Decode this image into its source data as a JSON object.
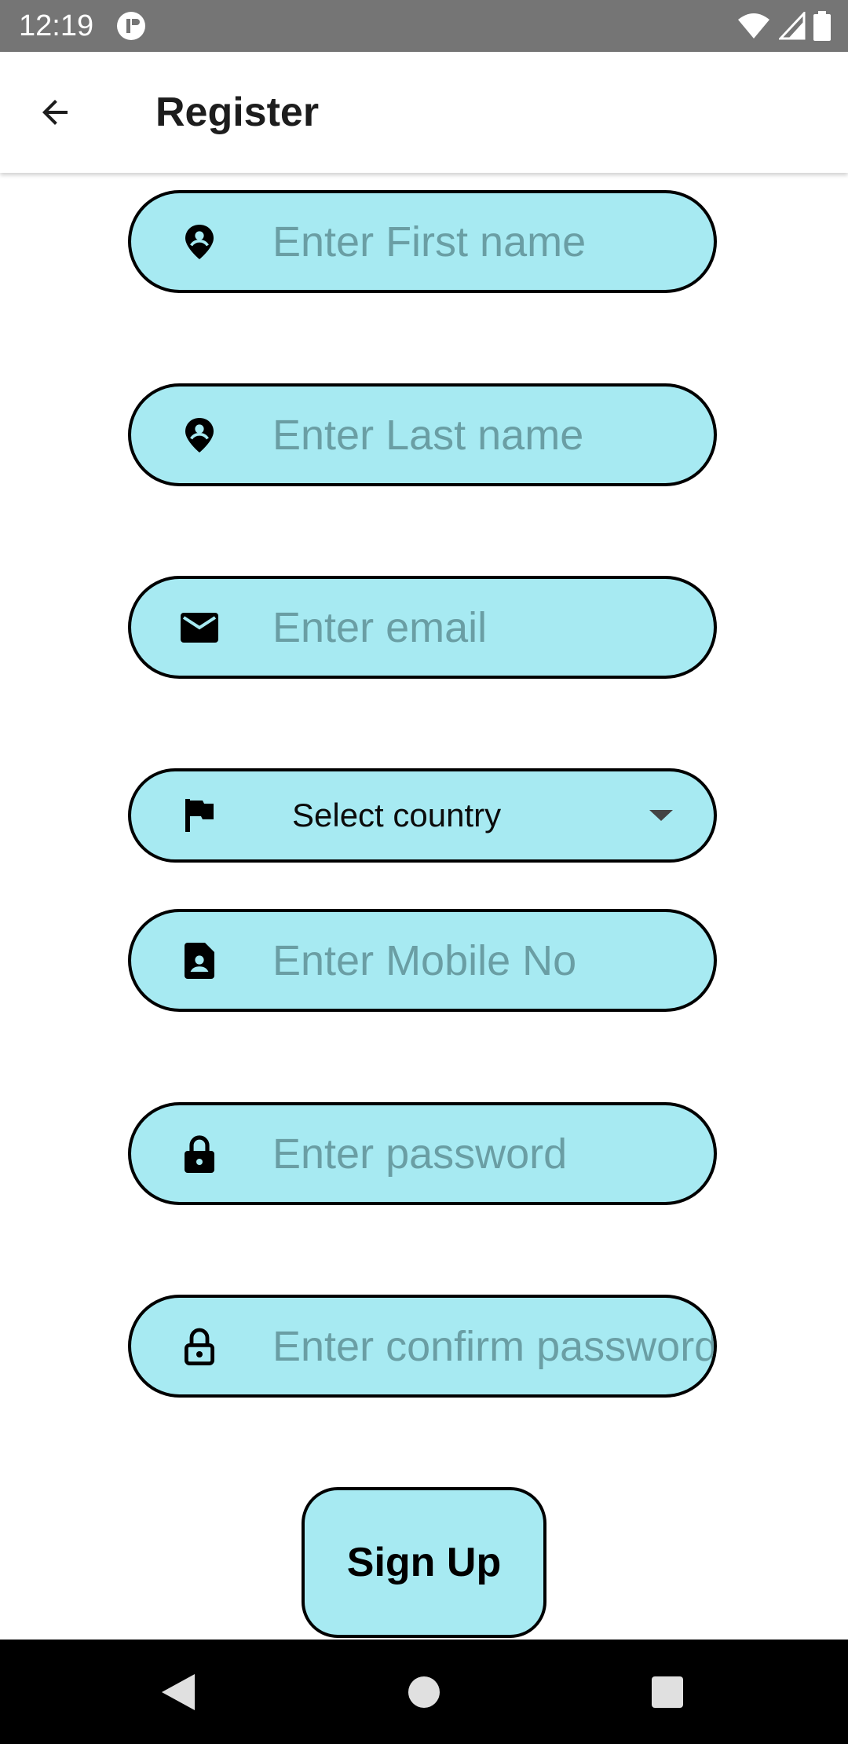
{
  "status_bar": {
    "time": "12:19"
  },
  "app_bar": {
    "title": "Register"
  },
  "form": {
    "first_name_placeholder": "Enter First name",
    "last_name_placeholder": "Enter Last name",
    "email_placeholder": "Enter email",
    "country_label": "Select country",
    "mobile_placeholder": "Enter Mobile No",
    "password_placeholder": "Enter password",
    "confirm_password_placeholder": "Enter confirm password",
    "signup_label": "Sign Up"
  },
  "icons": {
    "first_name": "person-pin-icon",
    "last_name": "person-pin-icon",
    "email": "mail-icon",
    "country": "flag-icon",
    "mobile": "contact-card-icon",
    "password": "lock-icon",
    "confirm_password": "lock-open-icon"
  },
  "colors": {
    "field_fill": "#a7eaf2",
    "placeholder": "#6a9ea4",
    "status_bar": "#757575"
  }
}
